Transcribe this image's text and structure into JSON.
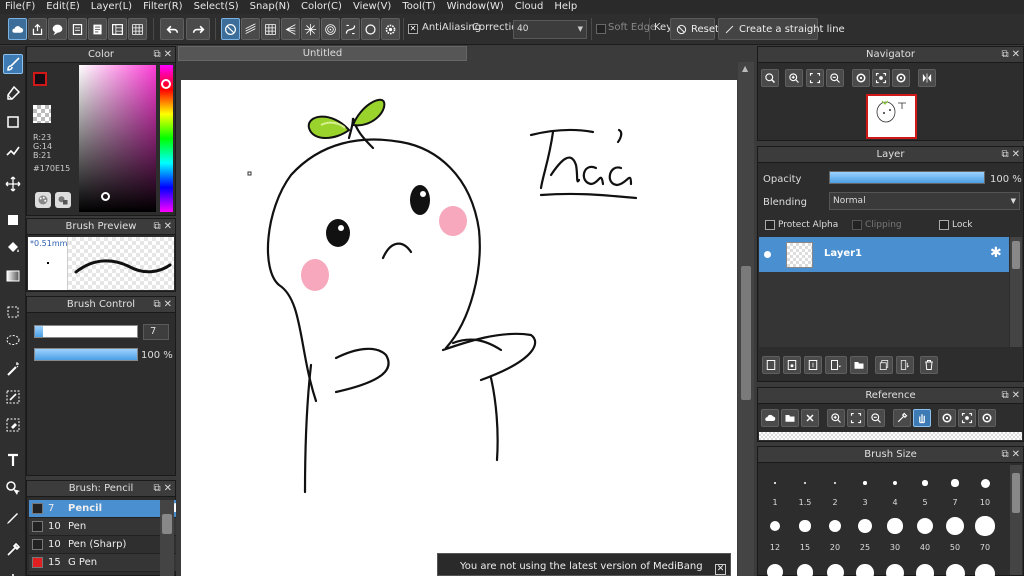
{
  "menu": [
    "File(F)",
    "Edit(E)",
    "Layer(L)",
    "Filter(R)",
    "Select(S)",
    "Snap(N)",
    "Color(C)",
    "View(V)",
    "Tool(T)",
    "Window(W)",
    "Cloud",
    "Help"
  ],
  "toolbar": {
    "antialiasing_label": "AntiAliasing",
    "correction_label": "Correction",
    "correction_value": "40",
    "soft_edge_label": "Soft Edge",
    "key_label": "Key",
    "reset_label": "Reset",
    "straight_line_label": "Create a straight line"
  },
  "color_panel": {
    "title": "Color",
    "r": "R:23",
    "g": "G:14",
    "b": "B:21",
    "hex": "#170E15",
    "fg_color": "#170e15"
  },
  "brush_preview": {
    "title": "Brush Preview",
    "size_label": "0.51mm"
  },
  "brush_control": {
    "title": "Brush Control",
    "size_value": "7",
    "opacity_value": "100 %",
    "size_level": 0.08,
    "opacity_level": 1.0
  },
  "brush_list": {
    "title": "Brush: Pencil",
    "items": [
      {
        "size": "7",
        "name": "Pencil",
        "color": "#222222",
        "selected": true
      },
      {
        "size": "10",
        "name": "Pen",
        "color": "#222222",
        "selected": false
      },
      {
        "size": "10",
        "name": "Pen (Sharp)",
        "color": "#222222",
        "selected": false
      },
      {
        "size": "15",
        "name": "G Pen",
        "color": "#e02020",
        "selected": false
      }
    ]
  },
  "document": {
    "tab_title": "Untitled",
    "handwritten_text": "Thảo"
  },
  "notice": "You are not using the latest version of MediBang Paint.",
  "navigator": {
    "title": "Navigator"
  },
  "layer_panel": {
    "title": "Layer",
    "opacity_label": "Opacity",
    "opacity_value": "100 %",
    "opacity_level": 1.0,
    "blending_label": "Blending",
    "blending_value": "Normal",
    "protect_alpha_label": "Protect Alpha",
    "clipping_label": "Clipping",
    "lock_label": "Lock",
    "layers": [
      {
        "name": "Layer1",
        "selected": true
      }
    ]
  },
  "reference": {
    "title": "Reference"
  },
  "brush_size": {
    "title": "Brush Size",
    "row1": [
      "1",
      "1.5",
      "2",
      "3",
      "4",
      "5",
      "7",
      "10"
    ],
    "row2": [
      "12",
      "15",
      "20",
      "25",
      "30",
      "40",
      "50",
      "70"
    ]
  },
  "colors": {
    "accent": "#4a90d0",
    "panel": "#2d2d2d",
    "leaf": "#9ad32c",
    "cheek": "#f7a8bd"
  }
}
